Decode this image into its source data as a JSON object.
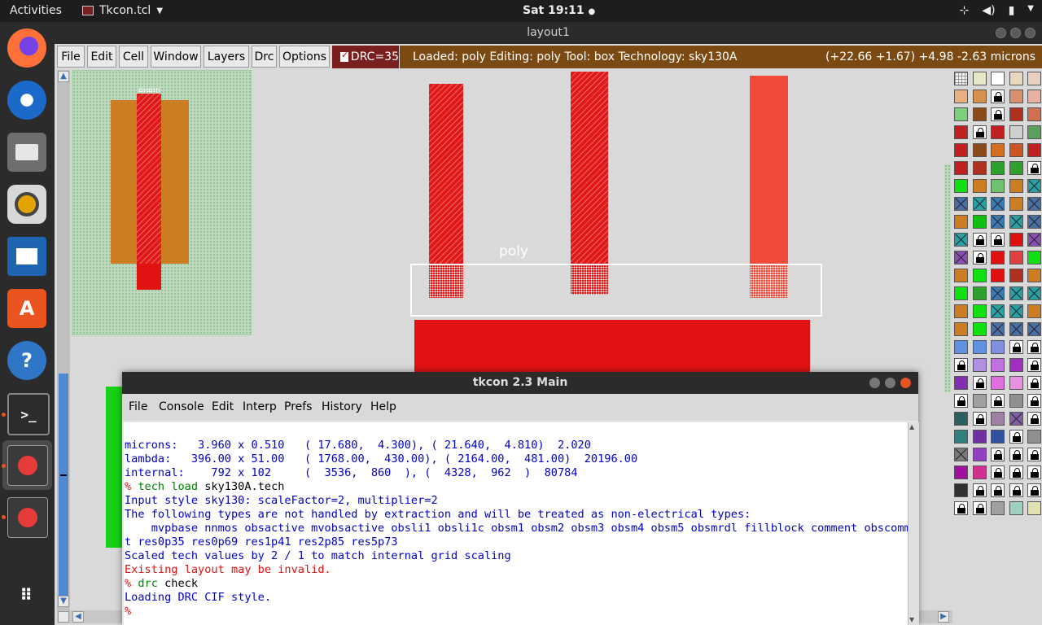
{
  "topbar": {
    "activities": "Activities",
    "app_name": "Tkcon.tcl",
    "clock": "Sat 19:11"
  },
  "magic": {
    "window_title": "layout1",
    "menu": [
      "File",
      "Edit",
      "Cell",
      "Window",
      "Layers",
      "Drc",
      "Options"
    ],
    "drc_label": "DRC=35",
    "status_text": "Loaded: poly Editing: poly Tool: box  Technology: sky130A",
    "coords": "(+22.66 +1.67) +4.98 -2.63 microns",
    "canvas_label": "poly",
    "colors": {
      "status_bg": "#7b4a13",
      "drc_bg": "#7a1f1f",
      "poly": "#e01818",
      "diff": "#cc7d22"
    }
  },
  "tkcon": {
    "title": "tkcon 2.3 Main",
    "menu": [
      "File",
      "Console",
      "Edit",
      "Interp",
      "Prefs",
      "History",
      "Help"
    ],
    "lines": [
      {
        "cls": "blue",
        "prompt": "",
        "cmd": "",
        "text": "microns:   3.960 x 0.510   ( 17.680,  4.300), ( 21.640,  4.810)  2.020"
      },
      {
        "cls": "blue",
        "prompt": "",
        "cmd": "",
        "text": "lambda:   396.00 x 51.00   ( 1768.00,  430.00), ( 2164.00,  481.00)  20196.00"
      },
      {
        "cls": "blue",
        "prompt": "",
        "cmd": "",
        "text": "internal:    792 x 102     (  3536,  860  ), (  4328,  962  )  80784"
      },
      {
        "cls": "cmd",
        "prompt": "% ",
        "cmd": "tech load",
        "text": " sky130A.tech"
      },
      {
        "cls": "blue",
        "prompt": "",
        "cmd": "",
        "text": "Input style sky130: scaleFactor=2, multiplier=2"
      },
      {
        "cls": "blue",
        "prompt": "",
        "cmd": "",
        "text": "The following types are not handled by extraction and will be treated as non-electrical types:"
      },
      {
        "cls": "blue",
        "prompt": "",
        "cmd": "",
        "text": "    mvpbase nnmos obsactive mvobsactive obsli1 obsli1c obsm1 obsm2 obsm3 obsm4 obsm5 obsmrdl fillblock comment obscommen"
      },
      {
        "cls": "blue",
        "prompt": "",
        "cmd": "",
        "text": "t res0p35 res0p69 res1p41 res2p85 res5p73"
      },
      {
        "cls": "blue",
        "prompt": "",
        "cmd": "",
        "text": "Scaled tech values by 2 / 1 to match internal grid scaling"
      },
      {
        "cls": "red",
        "prompt": "",
        "cmd": "",
        "text": "Existing layout may be invalid."
      },
      {
        "cls": "cmd",
        "prompt": "% ",
        "cmd": "drc",
        "text": " check"
      },
      {
        "cls": "blue",
        "prompt": "",
        "cmd": "",
        "text": "Loading DRC CIF style."
      },
      {
        "cls": "cmd",
        "prompt": "%",
        "cmd": "",
        "text": ""
      }
    ]
  },
  "dock": {
    "icons": [
      "firefox-icon",
      "thunderbird-icon",
      "files-icon",
      "rhythmbox-icon",
      "libreoffice-writer-icon",
      "software-center-icon",
      "help-icon",
      "terminal-icon",
      "magic-app-icon",
      "magic-app-icon-2",
      "show-apps-icon"
    ]
  }
}
